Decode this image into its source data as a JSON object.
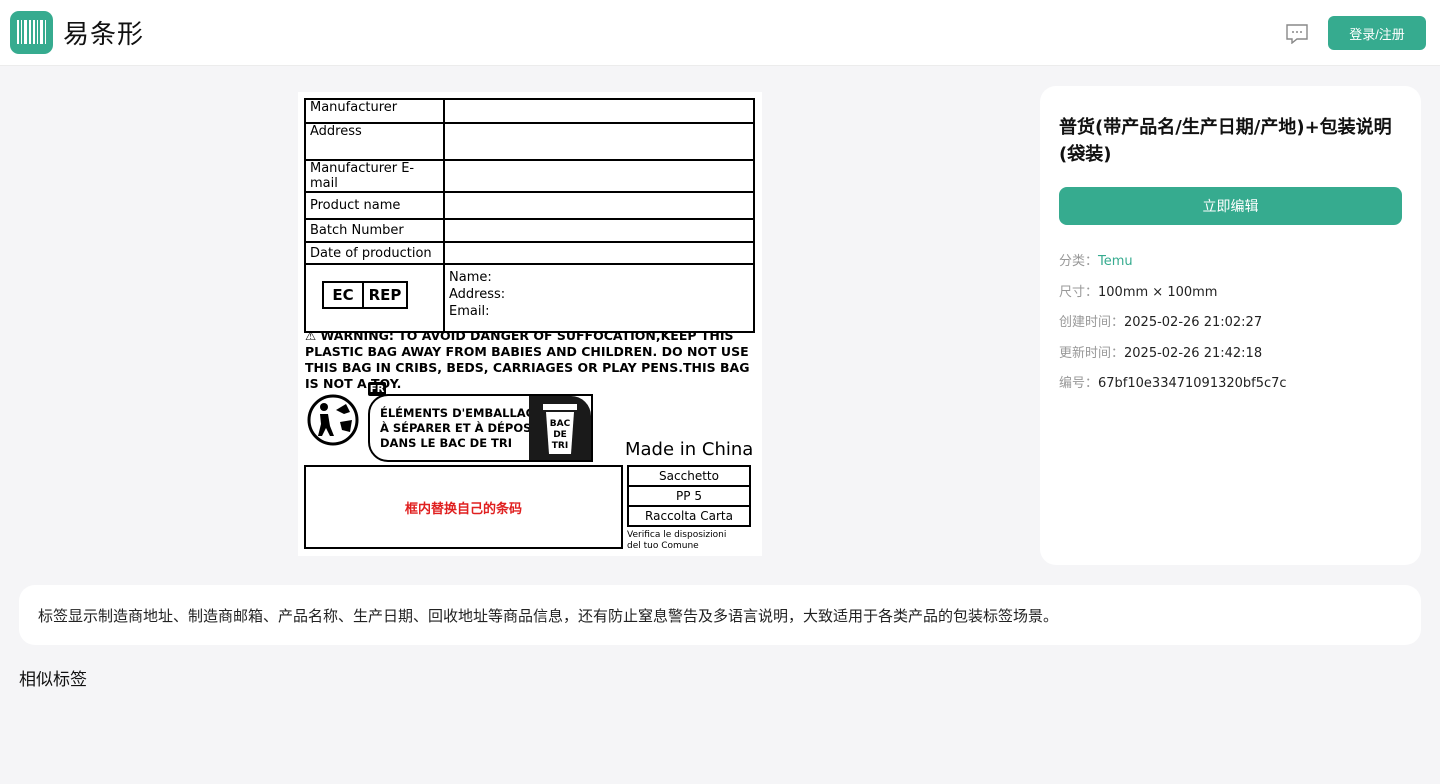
{
  "header": {
    "brand": "易条形",
    "login_label": "登录/注册"
  },
  "label": {
    "rows": [
      {
        "key": "Manufacturer"
      },
      {
        "key": "Address"
      },
      {
        "key": "Manufacturer E-mail"
      },
      {
        "key": "Product name"
      },
      {
        "key": "Batch Number"
      },
      {
        "key": "Date of production"
      }
    ],
    "ec": "EC",
    "rep": "REP",
    "name_line": "Name:",
    "address_line": "Address:",
    "email_line": "Email:",
    "warning": "⚠ WARNING: TO AVOID DANGER OF SUFFOCATION,KEEP THIS PLASTIC BAG AWAY FROM BABIES AND CHILDREN. DO NOT USE THIS BAG IN CRIBS, BEDS, CARRIAGES OR PLAY PENS.THIS BAG IS NOT A TOY.",
    "fr": "FR",
    "triman_line1": "ÉLÉMENTS D'EMBALLAGE",
    "triman_line2": "À SÉPARER ET À DÉPOSER",
    "triman_line3": "DANS LE BAC DE TRI",
    "bin_text1": "BAC",
    "bin_text2": "DE",
    "bin_text3": "TRI",
    "made_in": "Made in China",
    "barcode_placeholder": "框内替换自己的条码",
    "recycle": [
      "Sacchetto",
      "PP 5",
      "Raccolta Carta"
    ],
    "verifica_line1": "Verifica le disposizioni",
    "verifica_line2": "del tuo Comune"
  },
  "panel": {
    "title": "普货(带产品名/生产日期/产地)+包装说明(袋装)",
    "edit_label": "立即编辑",
    "category_label": "分类：",
    "category_value": "Temu",
    "size_label": "尺寸：",
    "size_value": "100mm × 100mm",
    "created_label": "创建时间：",
    "created_value": "2025-02-26 21:02:27",
    "updated_label": "更新时间：",
    "updated_value": "2025-02-26 21:42:18",
    "id_label": "编号：",
    "id_value": "67bf10e33471091320bf5c7c"
  },
  "description": "标签显示制造商地址、制造商邮箱、产品名称、生产日期、回收地址等商品信息，还有防止窒息警告及多语言说明，大致适用于各类产品的包装标签场景。",
  "similar_heading": "相似标签",
  "colors": {
    "accent": "#36ab8f",
    "barcode_text": "#e02020"
  }
}
